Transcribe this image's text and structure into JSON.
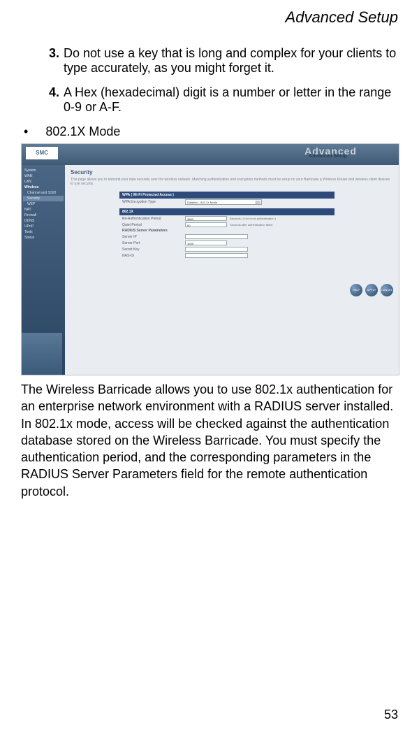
{
  "header": {
    "title": "Advanced Setup"
  },
  "list": {
    "item3": {
      "num": "3.",
      "text": "Do not use a key that is long and complex for your clients to type accurately, as you might forget it."
    },
    "item4": {
      "num": "4.",
      "text": "A Hex (hexadecimal) digit is a number or letter in the range 0-9 or A-F."
    }
  },
  "bullet": {
    "mark": "•",
    "text": "802.1X Mode"
  },
  "screenshot": {
    "logo": "SMC",
    "adv_bg": "Advanced",
    "adv_label": "Advanced Setup",
    "sidebar": [
      "System",
      "WAN",
      "LAN",
      "Wireless",
      "Channel and SSID",
      "Security",
      "WEP",
      "NAT",
      "Firewall",
      "DDNS",
      "UPnP",
      "Tools",
      "Status"
    ],
    "panel_title": "Security",
    "panel_desc": "This page allows you to transmit your data securely over the wireless network. Matching authentication and encryption methods must be setup on your Barricade g Wireless Router and wireless client devices to use security.",
    "wpa_header": "WPA ( Wi-Fi Protected Access )",
    "wpa_row_label": "WPA Encryption Type",
    "wpa_row_value": "Disabled - 802.1X Mode",
    "x_header": "802.1X",
    "rows": {
      "r1": {
        "label": "Re-Authentication Period",
        "value": "3600",
        "note": "Seconds ( 0 for no re-authentication )"
      },
      "r2": {
        "label": "Quiet Period",
        "value": "60",
        "note": "Seconds after authentication failed"
      },
      "r3": {
        "label": "RADIUS Server Parameters"
      },
      "r4": {
        "label": "Server IP",
        "value": ""
      },
      "r5": {
        "label": "Server Port",
        "value": "1645"
      },
      "r6": {
        "label": "Secret Key",
        "value": ""
      },
      "r7": {
        "label": "NAS-ID",
        "value": ""
      }
    },
    "buttons": [
      "HELP",
      "APPLY",
      "CANCEL"
    ]
  },
  "paragraph": "The Wireless Barricade allows you to use 802.1x authentication for an enterprise network environment with a RADIUS server installed. In 802.1x mode, access will be checked against the authentication database stored on the Wireless Barricade. You must specify the authentication period, and the corresponding parameters in the RADIUS Server Parameters field for the remote authentication protocol.",
  "page_number": "53"
}
